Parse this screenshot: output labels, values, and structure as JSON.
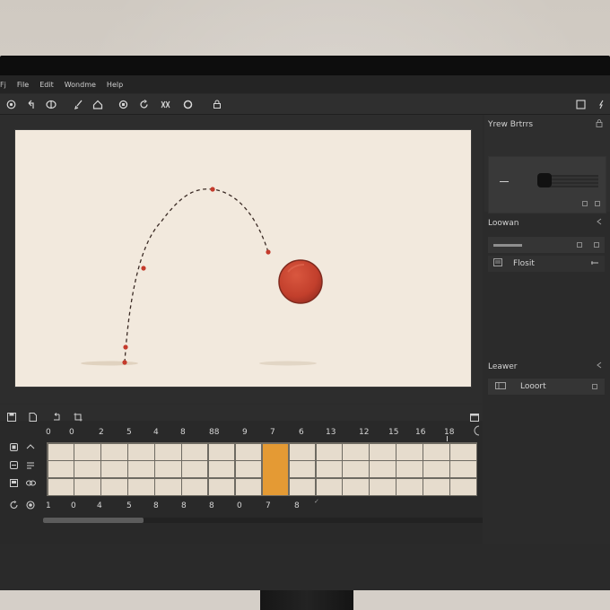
{
  "menu": [
    "Fj",
    "File",
    "Edit",
    "Wondme",
    "Help"
  ],
  "toolbar_icons": [
    "record-icon",
    "undo-icon",
    "eye-icon",
    "brush-icon",
    "home-icon",
    "cycle-icon",
    "rotate-icon",
    "loop-icon",
    "circle-icon",
    "lock-icon",
    "panel-icon",
    "pin-icon"
  ],
  "panels": {
    "properties": {
      "title": "Yrew Brtrrs"
    },
    "location": {
      "title": "Loowan",
      "item": "Flosit"
    },
    "layers": {
      "title": "Leawer",
      "item": "Looort"
    }
  },
  "timeline": {
    "top_numbers": [
      "0",
      "0",
      "2",
      "5",
      "4",
      "8",
      "88",
      "9",
      "7",
      "6",
      "13",
      "12",
      "15",
      "16",
      "18"
    ],
    "bottom_numbers": [
      "1",
      "0",
      "4",
      "5",
      "8",
      "8",
      "8",
      "0",
      "7",
      "8"
    ],
    "highlight_column": 8,
    "columns": 16,
    "rows": 3
  },
  "colors": {
    "stage_bg": "#f2e9dd",
    "ball": "#c8412f",
    "frame_highlight": "#e49a34",
    "ui_dark": "#2b2b2b"
  }
}
